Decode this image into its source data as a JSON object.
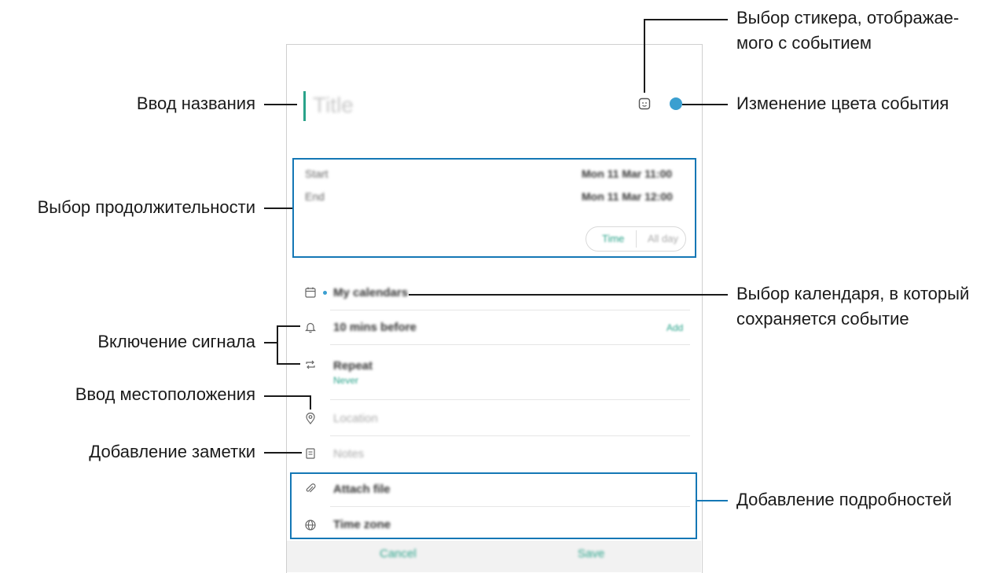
{
  "form": {
    "title_placeholder": "Title",
    "start_label": "Start",
    "start_value": "Mon 11 Mar  11:00",
    "end_label": "End",
    "end_value": "Mon 11 Mar  12:00",
    "toggle_time": "Time",
    "toggle_allday": "All day",
    "calendar": "My calendars",
    "reminder": "10 mins before",
    "reminder_action": "Add",
    "repeat": "Repeat",
    "repeat_value": "Never",
    "location": "Location",
    "notes": "Notes",
    "attach": "Attach file",
    "timezone": "Time zone",
    "cancel": "Cancel",
    "save": "Save"
  },
  "callouts": {
    "title": "Ввод названия",
    "duration": "Выбор продолжительности",
    "alarm": "Включение сигнала",
    "location": "Ввод местоположения",
    "note": "Добавление заметки",
    "sticker_line1": "Выбор стикера, отображае-",
    "sticker_line2": "мого с событием",
    "color": "Изменение цвета события",
    "calendar_line1": "Выбор календаря, в который",
    "calendar_line2": "сохраняется событие",
    "details": "Добавление подробностей"
  },
  "colors": {
    "accent": "#2aa38a",
    "highlight": "#1477b5",
    "event_color": "#3b9fd0"
  }
}
